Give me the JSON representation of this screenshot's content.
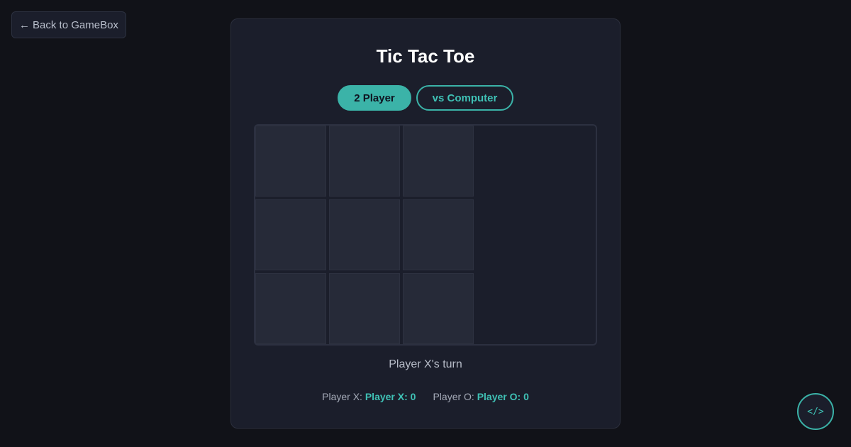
{
  "nav": {
    "back_arrow": "←",
    "back_label": "Back to GameBox"
  },
  "game": {
    "title": "Tic Tac Toe",
    "modes": [
      "2 Player",
      "vs Computer"
    ],
    "active_mode": "2 Player",
    "board": [
      "",
      "",
      "",
      "",
      "",
      "",
      "",
      "",
      ""
    ],
    "status": "Player X's turn",
    "scores": {
      "x_label": "Player X:",
      "x_value": "Player X: 0",
      "o_label": "Player O:",
      "o_value": "Player O: 0"
    }
  },
  "code_button": {
    "label": "</>"
  },
  "colors": {
    "accent": "#3bb3a8",
    "background": "#111218",
    "card": "#1b1e2b",
    "cell": "#262a38"
  },
  "icons": {
    "back": "arrow-left-icon",
    "code": "code-icon"
  }
}
